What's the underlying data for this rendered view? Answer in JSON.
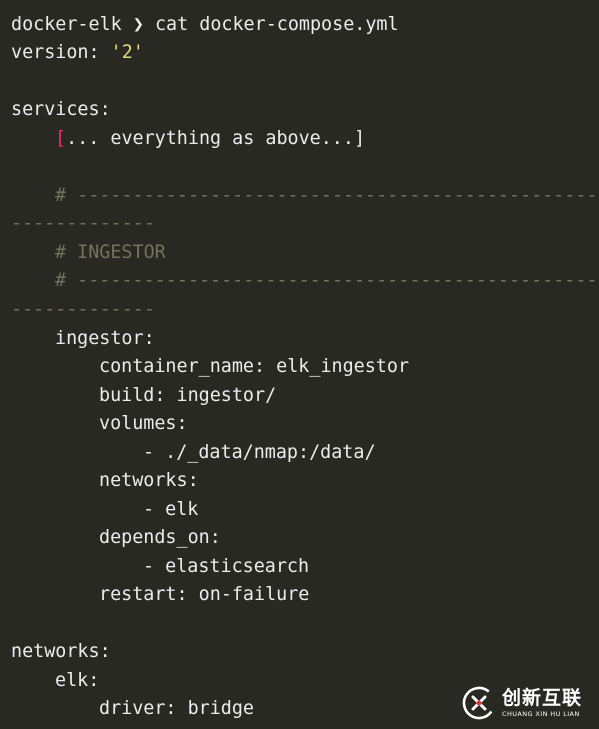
{
  "terminal": {
    "prompt_dir": "docker-elk",
    "prompt_symbol": "❯",
    "command": "cat docker-compose.yml",
    "version_key": "version:",
    "version_value": "'2'",
    "services_key": "services:",
    "placeholder_open": "[",
    "placeholder_text": "... everything as above...",
    "placeholder_close": "]",
    "comment_hash": "# ",
    "comment_dashes": "-----------------------------------------------------------------------------------------------",
    "comment_wrap": "-------------",
    "section_comment": "# INGESTOR",
    "ingestor_key": "ingestor:",
    "container_name": "container_name: elk_ingestor",
    "build": "build: ingestor/",
    "volumes_key": "volumes:",
    "volume_item": "- ./_data/nmap:/data/",
    "networks_key_service": "networks:",
    "network_item": "- elk",
    "depends_key": "depends_on:",
    "depends_item": "- elasticsearch",
    "restart": "restart: on-failure",
    "networks_key": "networks:",
    "elk_key": "elk:",
    "driver": "driver: bridge"
  },
  "watermark": {
    "name": "创新互联",
    "pinyin": "CHUANG XIN HU LIAN"
  },
  "colors": {
    "background": "#282923",
    "text": "#ececec",
    "comment": "#75715e",
    "string": "#e6db74",
    "bracket": "#f92672"
  }
}
